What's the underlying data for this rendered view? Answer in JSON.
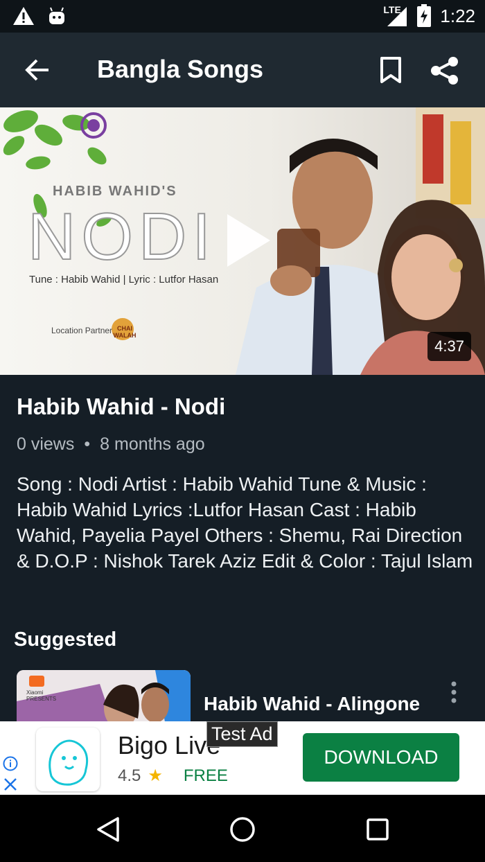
{
  "status_bar": {
    "time": "1:22",
    "network": "LTE",
    "icons": [
      "warning-icon",
      "android-icon",
      "signal-icon",
      "battery-charging-icon"
    ]
  },
  "app_bar": {
    "title": "Bangla Songs",
    "icons": [
      "back-arrow-icon",
      "bookmark-icon",
      "share-icon"
    ]
  },
  "video": {
    "duration": "4:37",
    "thumbnail_text": {
      "headline": "HABIB WAHID'S",
      "song": "NODI",
      "credits": "Tune : Habib Wahid | Lyric : Lutfor Hasan",
      "partner": "Location Partner",
      "partner_logo": "CHAI WALAH"
    },
    "title": "Habib Wahid - Nodi",
    "views": "0 views",
    "age": "8 months ago",
    "description": "Song : Nodi Artist : Habib Wahid Tune & Music : Habib Wahid Lyrics :Lutfor Hasan Cast : Habib Wahid, Payelia Payel Others : Shemu, Rai Direction & D.O.P : Nishok Tarek Aziz Edit & Color : Tajul Islam"
  },
  "suggested": {
    "heading": "Suggested",
    "items": [
      {
        "title": "Habib Wahid - Alingone",
        "thumb_text": "Xiaomi PRESENTS"
      }
    ]
  },
  "ad": {
    "label": "Test Ad",
    "app_name": "Bigo Live",
    "rating": "4.5",
    "price": "FREE",
    "cta": "DOWNLOAD"
  },
  "colors": {
    "background": "#151e26",
    "app_bar": "#1f2931",
    "ad_button": "#0b8043",
    "star": "#f4b400"
  }
}
